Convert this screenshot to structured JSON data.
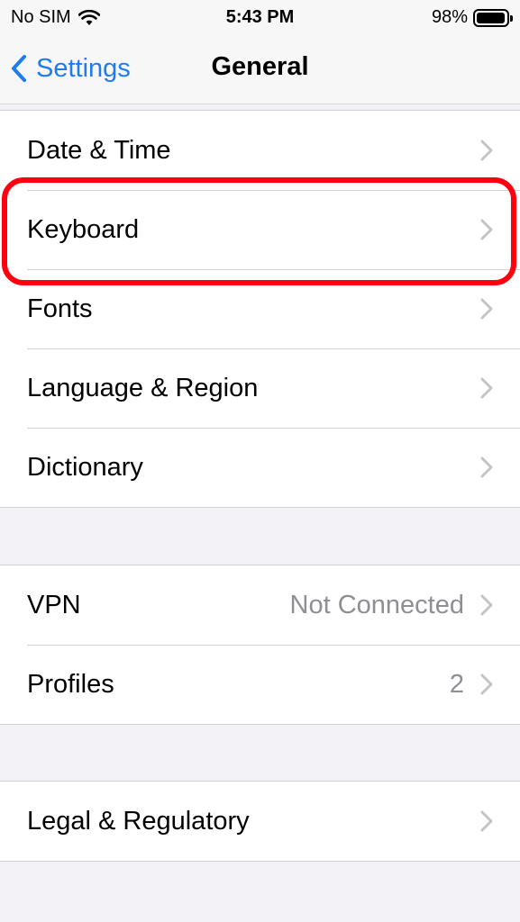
{
  "status_bar": {
    "carrier": "No SIM",
    "time": "5:43 PM",
    "battery_percent": "98%",
    "battery_level": 0.98
  },
  "nav": {
    "back_label": "Settings",
    "title": "General"
  },
  "groups": [
    {
      "rows": [
        {
          "label": "Date & Time",
          "value": ""
        },
        {
          "label": "Keyboard",
          "value": ""
        },
        {
          "label": "Fonts",
          "value": ""
        },
        {
          "label": "Language & Region",
          "value": ""
        },
        {
          "label": "Dictionary",
          "value": ""
        }
      ]
    },
    {
      "rows": [
        {
          "label": "VPN",
          "value": "Not Connected"
        },
        {
          "label": "Profiles",
          "value": "2"
        }
      ]
    },
    {
      "rows": [
        {
          "label": "Legal & Regulatory",
          "value": ""
        }
      ]
    }
  ],
  "colors": {
    "accent": "#1e7cf0",
    "highlight": "#ff0010",
    "secondary_text": "#8e8e93",
    "background": "#f2f2f7"
  },
  "icons": [
    "wifi-icon",
    "battery-icon",
    "chevron-left-icon",
    "chevron-right-icon"
  ]
}
